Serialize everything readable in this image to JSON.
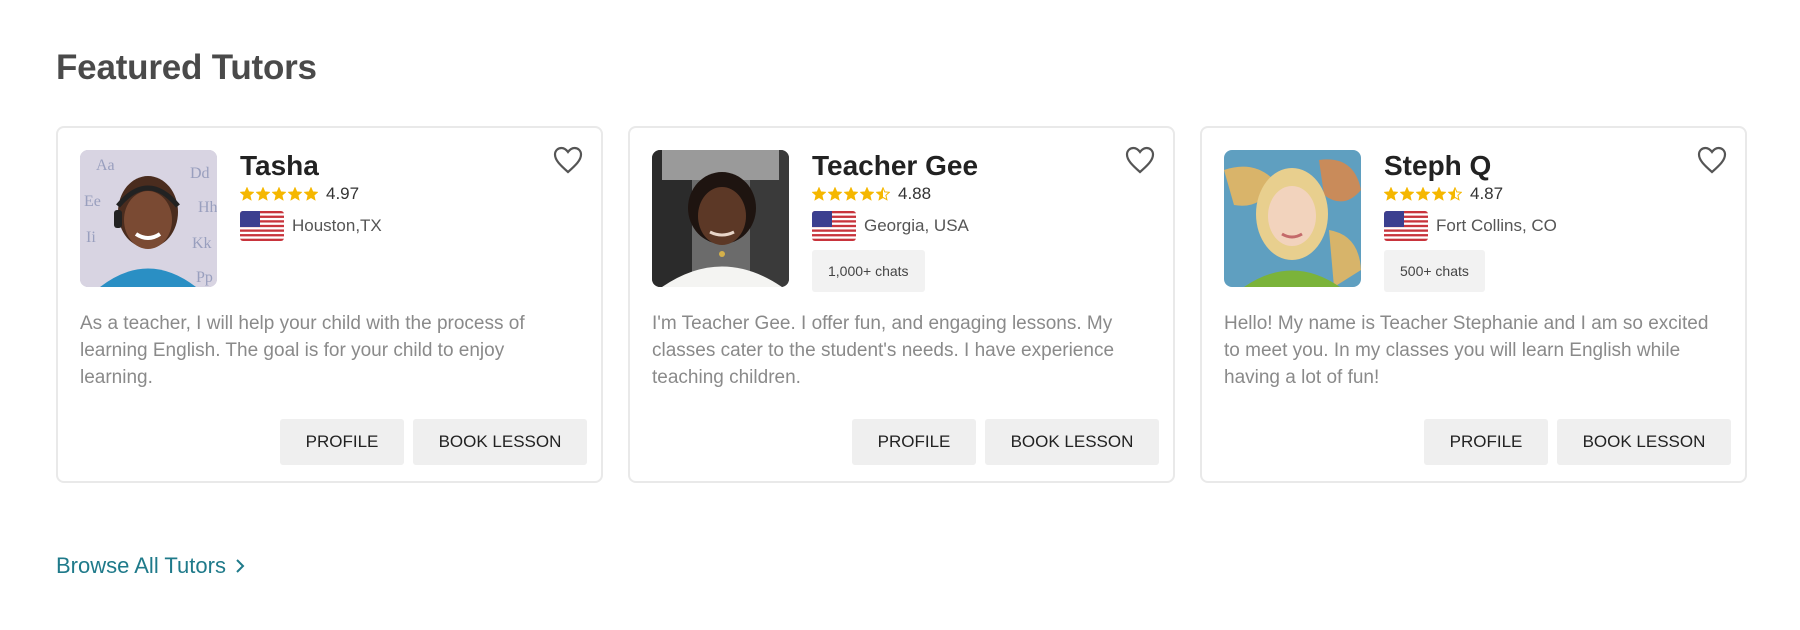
{
  "section": {
    "title": "Featured Tutors"
  },
  "colors": {
    "star": "#f5b700",
    "heart_outline": "#555555",
    "link": "#1f7a8a",
    "button_bg": "#efefef"
  },
  "tutors": [
    {
      "name": "Tasha",
      "rating": "4.97",
      "stars": 5,
      "location": "Houston,TX",
      "flag_icon": "us-flag-icon",
      "chats": "",
      "bio": "As a teacher, I will help your child with the process of learning English. The goal is for your child to enjoy learning.",
      "profile_label": "PROFILE",
      "book_label": "BOOK LESSON"
    },
    {
      "name": "Teacher Gee",
      "rating": "4.88",
      "stars": 4.5,
      "location": "Georgia, USA",
      "flag_icon": "us-flag-icon",
      "chats": "1,000+ chats",
      "bio": "I'm Teacher Gee. I offer fun, and engaging lessons. My classes cater to the student's needs. I have experience teaching children.",
      "profile_label": "PROFILE",
      "book_label": "BOOK LESSON"
    },
    {
      "name": "Steph Q",
      "rating": "4.87",
      "stars": 4.5,
      "location": "Fort Collins, CO",
      "flag_icon": "us-flag-icon",
      "chats": "500+ chats",
      "bio": "Hello! My name is Teacher Stephanie and I am so excited to meet you. In my classes you will learn English while having a lot of fun!",
      "profile_label": "PROFILE",
      "book_label": "BOOK LESSON"
    }
  ],
  "browse": {
    "label": "Browse All Tutors"
  }
}
